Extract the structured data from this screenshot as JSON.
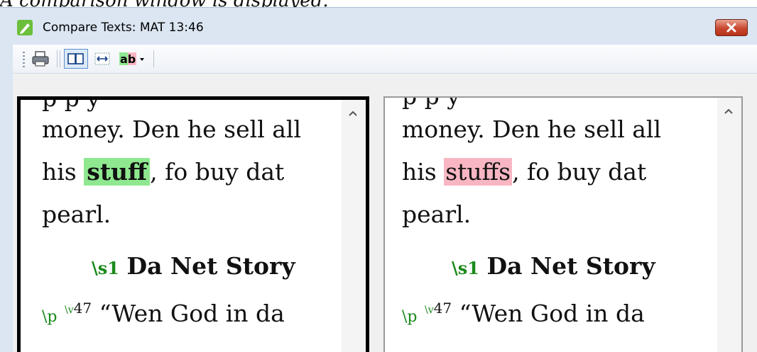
{
  "caption": "A comparison window is displayed.",
  "window": {
    "title": "Compare Texts: MAT 13:46",
    "close_icon": "close-x-icon"
  },
  "toolbar": {
    "buttons": [
      "print-icon",
      "side-by-side-icon",
      "fit-width-icon",
      "highlight-differences-icon"
    ],
    "highlight_label": "ab"
  },
  "left_pane": {
    "cut_line": "p              p         y",
    "line1": "money. Den he sell all",
    "line2_before": "his ",
    "line2_highlight": "stuff",
    "line2_after": ", fo buy dat",
    "line3": "pearl.",
    "heading_marker": "\\s1",
    "heading_text": "Da Net Story",
    "para_marker": "\\p",
    "verse_marker": "\\v",
    "verse_num": "47",
    "verse_text": "“Wen God in da"
  },
  "right_pane": {
    "cut_line": "p              p         y",
    "line1": "money. Den he sell all",
    "line2_before": "his ",
    "line2_highlight": "stuffs",
    "line2_after": ", fo buy dat",
    "line3": "pearl.",
    "heading_marker": "\\s1",
    "heading_text": "Da Net Story",
    "para_marker": "\\p",
    "verse_marker": "\\v",
    "verse_num": "47",
    "verse_text": "“Wen God in da"
  },
  "colors": {
    "insertion_highlight": "#8fe88f",
    "deletion_highlight": "#f8b6c2",
    "marker_green": "#1a8a1a"
  }
}
